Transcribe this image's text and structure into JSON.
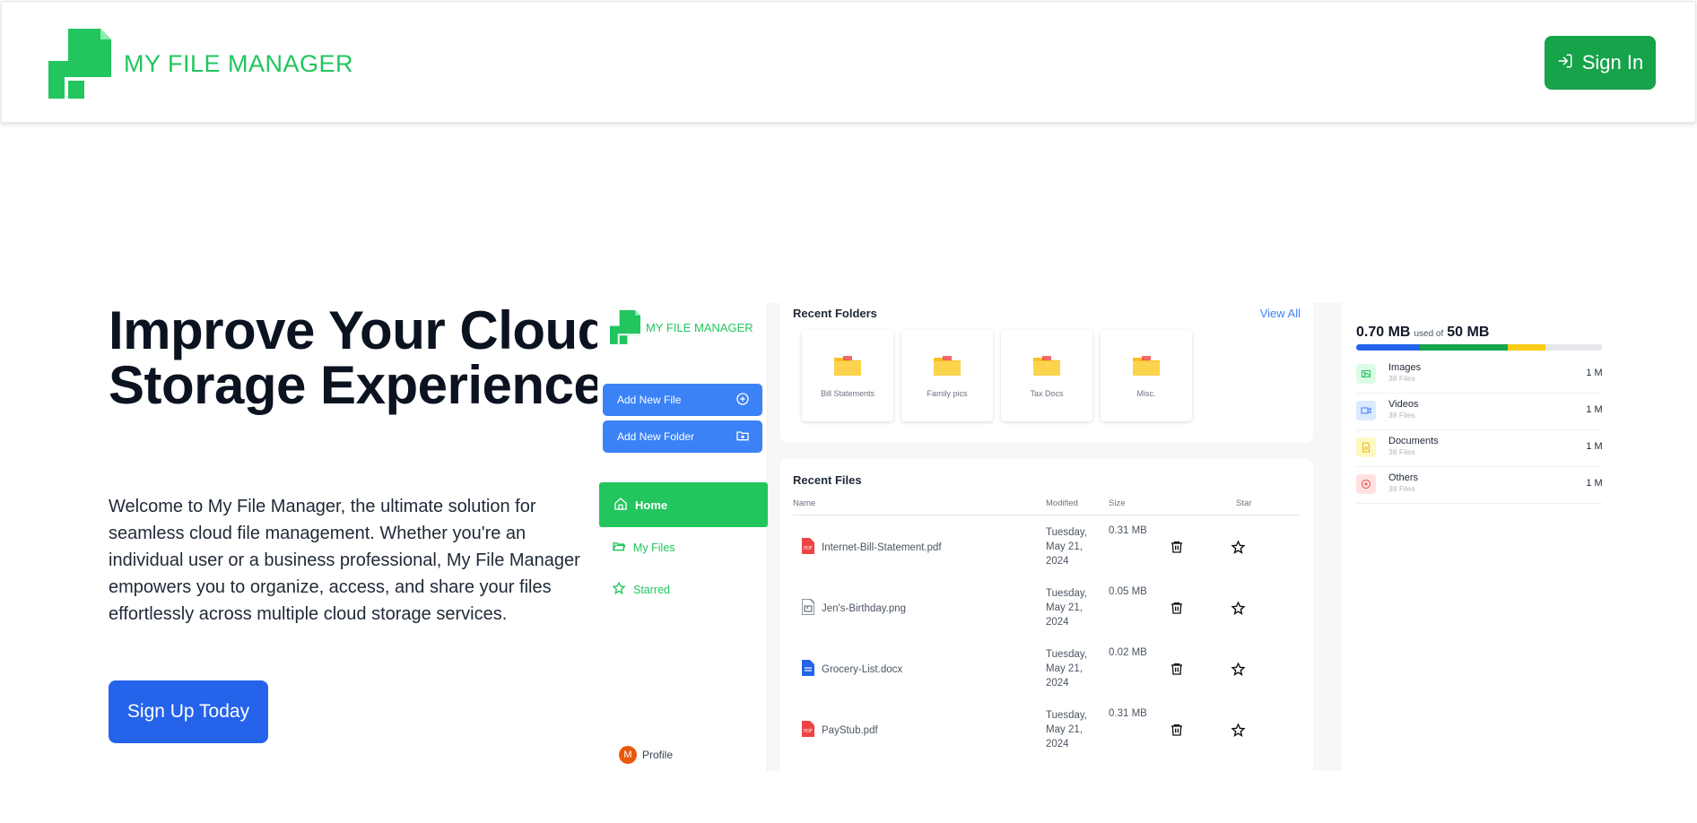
{
  "header": {
    "brand_name": "MY FILE MANAGER",
    "signin_label": "Sign In",
    "brand_color": "#22c55e",
    "signin_color": "#16a34a"
  },
  "hero": {
    "title": "Improve Your Cloud Storage Experience",
    "description": "Welcome to My File Manager, the ultimate solution for seamless cloud file management. Whether you're an individual user or a business professional, My File Manager empowers you to organize, access, and share your files effortlessly across multiple cloud storage services.",
    "cta_label": "Sign Up Today",
    "cta_color": "#2563eb"
  },
  "preview": {
    "sidebar": {
      "brand_name": "MY FILE MANAGER",
      "add_file_label": "Add New File",
      "add_folder_label": "Add New Folder",
      "nav": [
        {
          "label": "Home",
          "icon": "home-icon",
          "active": true
        },
        {
          "label": "My Files",
          "icon": "folder-open-icon",
          "active": false
        },
        {
          "label": "Starred",
          "icon": "star-icon",
          "active": false
        }
      ],
      "profile": {
        "initial": "M",
        "label": "Profile"
      }
    },
    "recent_folders": {
      "title": "Recent Folders",
      "view_all": "View All",
      "folders": [
        "Bill Statements",
        "Family pics",
        "Tax Docs",
        "Misc."
      ]
    },
    "recent_files": {
      "title": "Recent Files",
      "columns": [
        "Name",
        "Modified",
        "Size",
        "Star"
      ],
      "rows": [
        {
          "name": "Internet-Bill-Statement.pdf",
          "type": "pdf",
          "modified": "Tuesday, May 21, 2024",
          "size": "0.31 MB"
        },
        {
          "name": "Jen's-Birthday.png",
          "type": "image",
          "modified": "Tuesday, May 21, 2024",
          "size": "0.05 MB"
        },
        {
          "name": "Grocery-List.docx",
          "type": "doc",
          "modified": "Tuesday, May 21, 2024",
          "size": "0.02 MB"
        },
        {
          "name": "PayStub.pdf",
          "type": "pdf",
          "modified": "Tuesday, May 21, 2024",
          "size": "0.31 MB"
        }
      ]
    },
    "storage": {
      "used": "0.70 MB",
      "used_of": "used of",
      "total": "50 MB",
      "bar_segments": [
        {
          "color": "#2563eb",
          "fraction": 0.25
        },
        {
          "color": "#16a34a",
          "fraction": 0.35
        },
        {
          "color": "#facc15",
          "fraction": 0.15
        }
      ],
      "categories": [
        {
          "label": "Images",
          "sub": "38 Files",
          "size": "1 MB",
          "color": "#22c55e",
          "bg": "#dcfce7"
        },
        {
          "label": "Videos",
          "sub": "38 Files",
          "size": "1 MB",
          "color": "#3b82f6",
          "bg": "#dbeafe"
        },
        {
          "label": "Documents",
          "sub": "38 Files",
          "size": "1 MB",
          "color": "#eab308",
          "bg": "#fef9c3"
        },
        {
          "label": "Others",
          "sub": "38 Files",
          "size": "1 MB",
          "color": "#ef4444",
          "bg": "#fee2e2"
        }
      ]
    }
  }
}
